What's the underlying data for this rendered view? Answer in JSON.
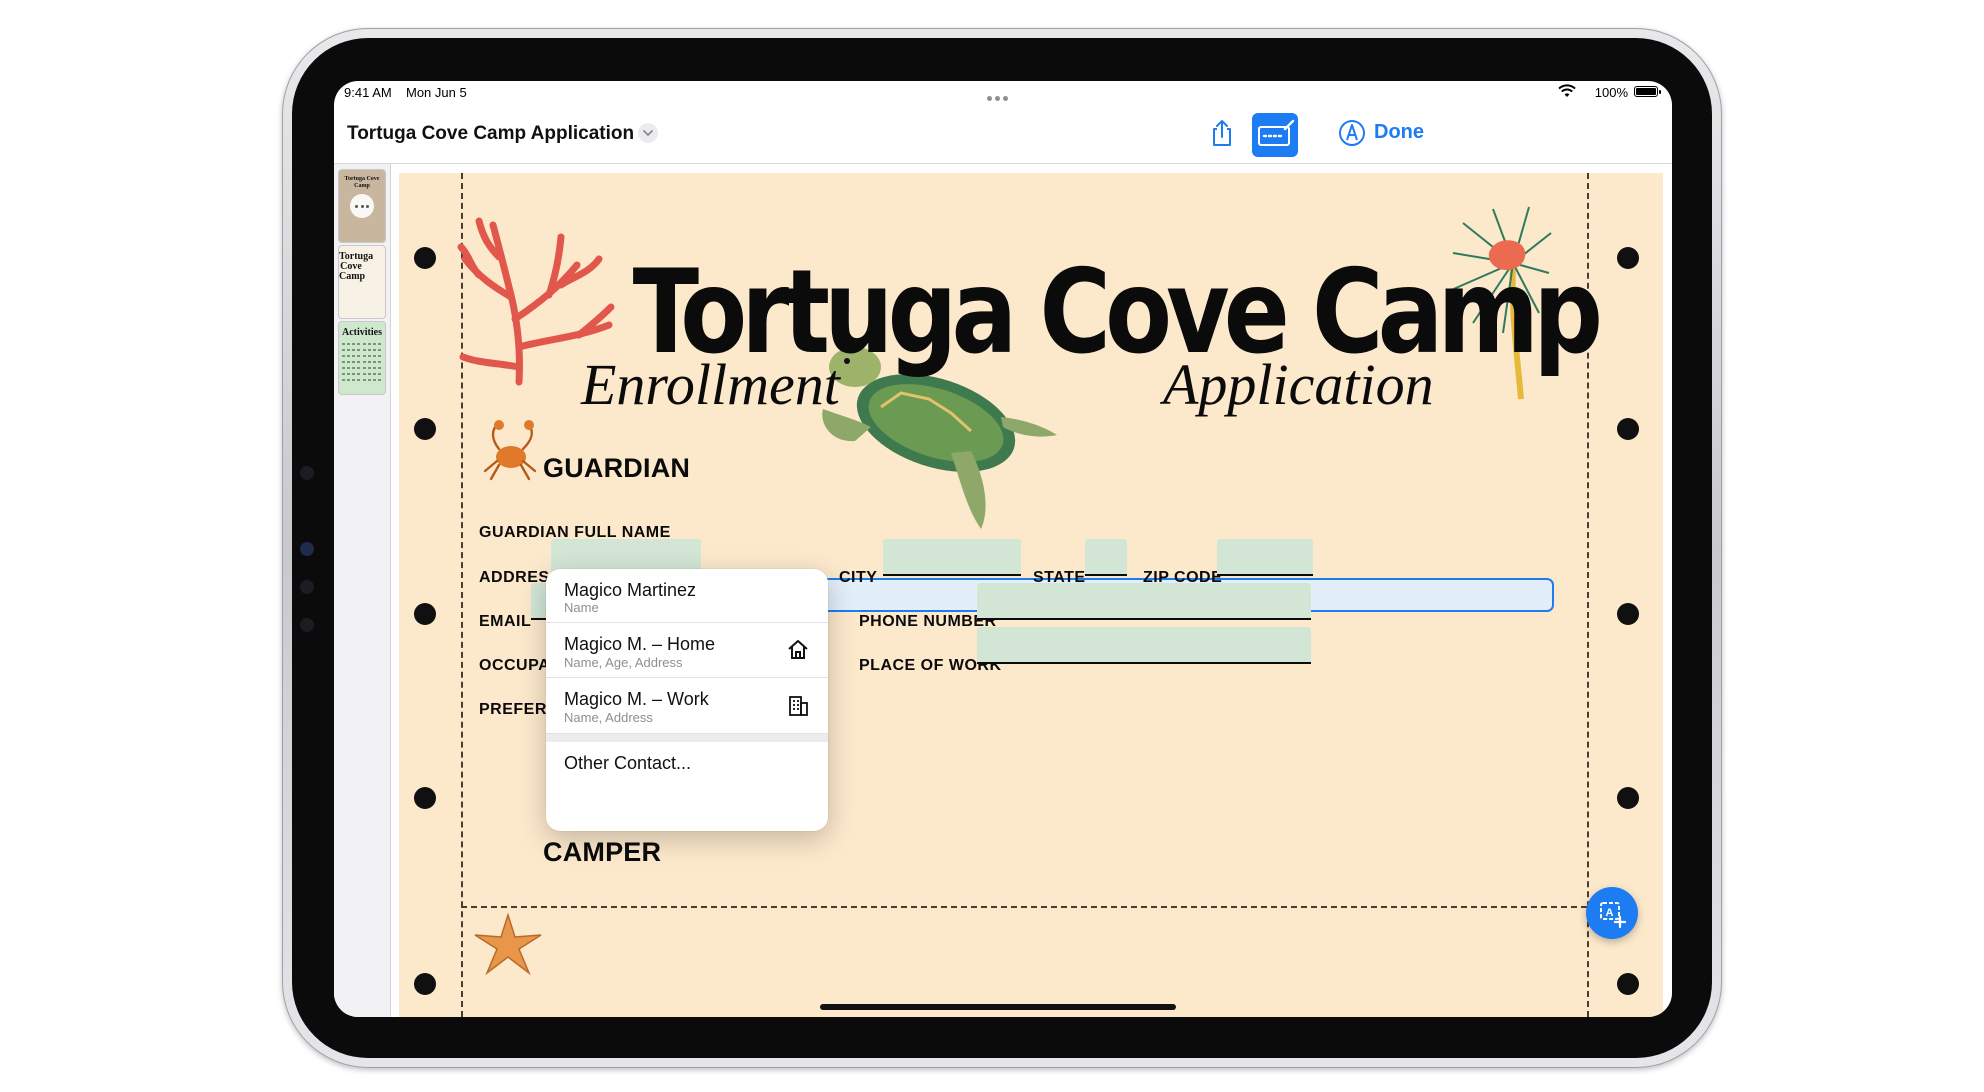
{
  "status_bar": {
    "time": "9:41 AM",
    "date": "Mon Jun 5",
    "battery": "100%",
    "battery_level": 1.0
  },
  "toolbar": {
    "document_title": "Tortuga Cove Camp Application",
    "title_menu_icon": "chevron-down-icon",
    "share_icon": "share-icon",
    "form_fill_icon": "form-fill-icon",
    "markup_icon": "markup-pen-icon",
    "done_label": "Done",
    "accent_color": "#1e7cf2"
  },
  "thumbnails": [
    {
      "label": "Tortuga Cove Camp",
      "more_icon": "ellipsis-icon"
    },
    {
      "label": "Tortuga Cove Camp"
    },
    {
      "label": "Activities"
    }
  ],
  "form": {
    "title": "Tortuga Cove Camp",
    "subtitle_left": "Enrollment",
    "subtitle_right": "Application",
    "background_color": "#fce8cb",
    "field_fill_color": "#d3e6d6",
    "sections": {
      "guardian": "GUARDIAN",
      "camper": "CAMPER"
    },
    "labels": {
      "guardian_full_name": "GUARDIAN FULL NAME",
      "address": "ADDRESS",
      "city": "CITY",
      "state": "STATE",
      "zip_code": "ZIP CODE",
      "email": "EMAIL",
      "phone_number": "PHONE NUMBER",
      "occupation": "OCCUPATION",
      "place_of_work": "PLACE OF WORK",
      "preferred_contact": "PREFERRED CONTACT"
    },
    "guardian_full_name_value": ""
  },
  "autofill_menu": {
    "items": [
      {
        "title": "Magico Martinez",
        "subtitle": "Name",
        "icon": ""
      },
      {
        "title": "Magico M. – Home",
        "subtitle": "Name, Age, Address",
        "icon": "house-icon"
      },
      {
        "title": "Magico M. – Work",
        "subtitle": "Name, Address",
        "icon": "building-icon"
      }
    ],
    "other_label": "Other Contact..."
  },
  "fab": {
    "icon": "add-text-field-icon"
  }
}
